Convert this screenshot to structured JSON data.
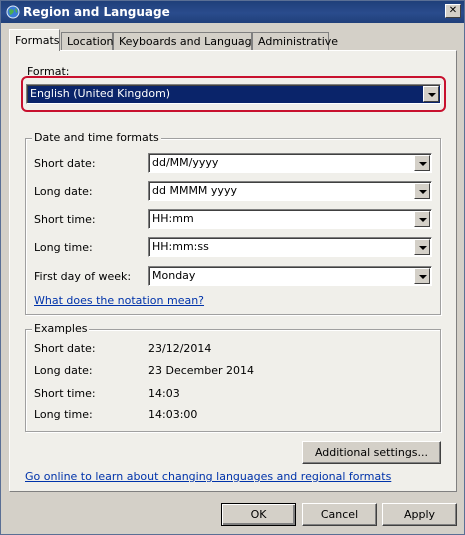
{
  "window": {
    "title": "Region and Language"
  },
  "tabs": [
    "Formats",
    "Location",
    "Keyboards and Languages",
    "Administrative"
  ],
  "format": {
    "label": "Format:",
    "value": "English (United Kingdom)"
  },
  "datetime": {
    "group_title": "Date and time formats",
    "rows": [
      {
        "label": "Short date:",
        "value": "dd/MM/yyyy"
      },
      {
        "label": "Long date:",
        "value": "dd MMMM yyyy"
      },
      {
        "label": "Short time:",
        "value": "HH:mm"
      },
      {
        "label": "Long time:",
        "value": "HH:mm:ss"
      },
      {
        "label": "First day of week:",
        "value": "Monday"
      }
    ],
    "notation_link": "What does the notation mean?"
  },
  "examples": {
    "group_title": "Examples",
    "rows": [
      {
        "label": "Short date:",
        "value": "23/12/2014"
      },
      {
        "label": "Long date:",
        "value": "23 December 2014"
      },
      {
        "label": "Short time:",
        "value": "14:03"
      },
      {
        "label": "Long time:",
        "value": "14:03:00"
      }
    ]
  },
  "additional_settings": "Additional settings...",
  "online_link": "Go online to learn about changing languages and regional formats",
  "buttons": {
    "ok": "OK",
    "cancel": "Cancel",
    "apply": "Apply"
  },
  "colors": {
    "titlebar": "#1f3f7a",
    "highlight": "#c8102e",
    "selection": "#0a246a",
    "link": "#0033aa"
  }
}
